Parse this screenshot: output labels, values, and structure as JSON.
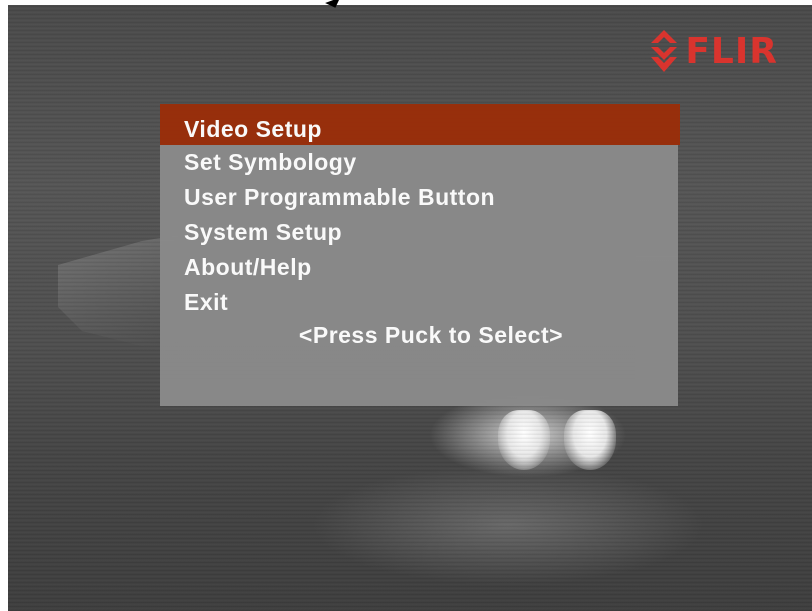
{
  "brand": {
    "logo_text": "FLIR",
    "logo_color": "#d9342e"
  },
  "menu": {
    "selected_index": 0,
    "selected_color": "#9a2e0a",
    "items": [
      {
        "label": "Video Setup"
      },
      {
        "label": "Set Symbology"
      },
      {
        "label": "User Programmable Button"
      },
      {
        "label": "System Setup"
      },
      {
        "label": "About/Help"
      },
      {
        "label": "Exit"
      }
    ],
    "hint": "<Press Puck to Select>"
  }
}
